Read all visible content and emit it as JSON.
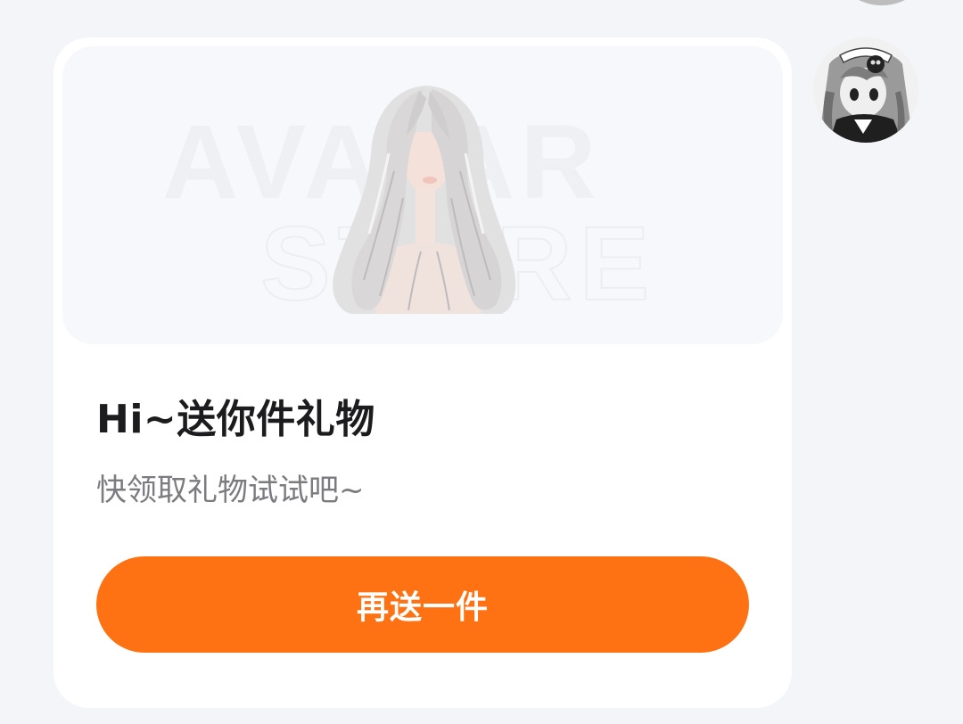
{
  "chat": {
    "previous_avatar": {
      "icon": "user-avatar-icon"
    },
    "sender_avatar": {
      "icon": "user-avatar-icon"
    }
  },
  "gift_card": {
    "banner": {
      "watermark_line1": "AVATAR",
      "watermark_line2": "STORE",
      "item_icon": "hair-item-icon"
    },
    "title": "Hi~送你件礼物",
    "subtitle": "快领取礼物试试吧~",
    "button_label": "再送一件"
  },
  "colors": {
    "background": "#f3f5f8",
    "card": "#ffffff",
    "banner": "#f7f8fb",
    "accent": "#fe7214",
    "title": "#1c1c1e",
    "subtitle": "#7b7b80"
  }
}
